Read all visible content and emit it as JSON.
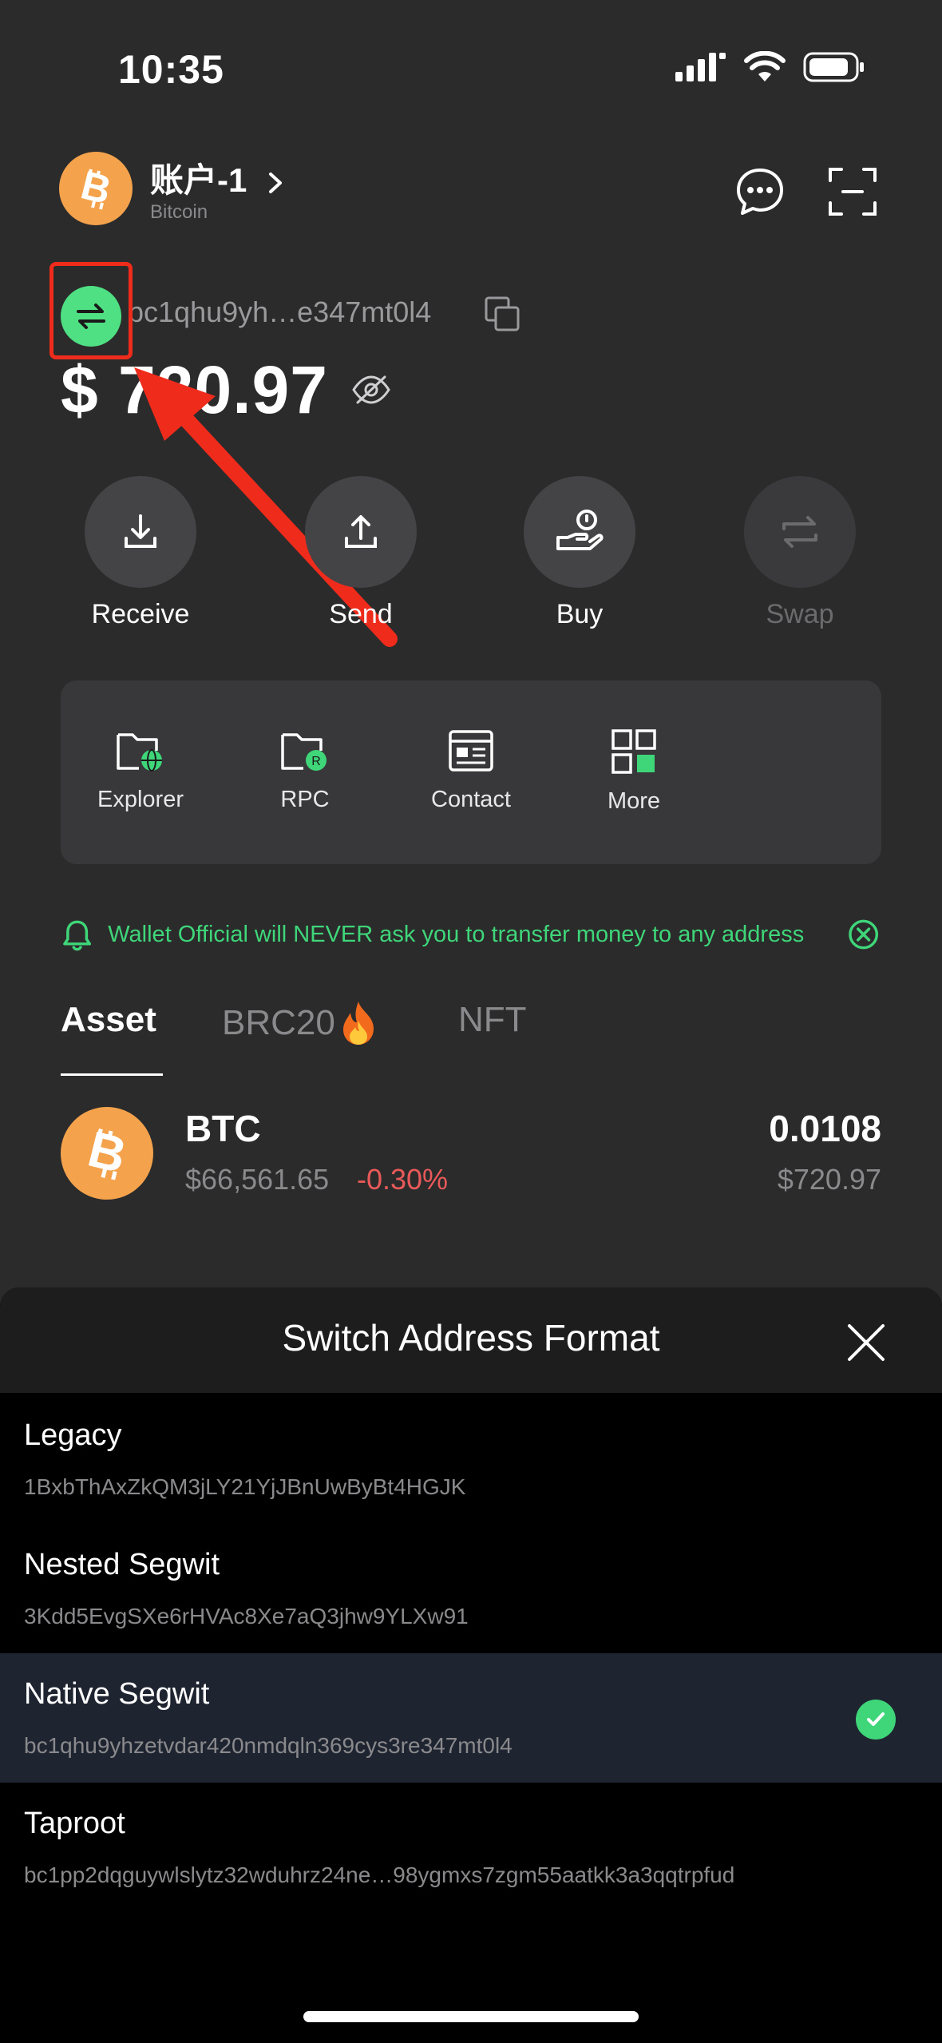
{
  "status_bar": {
    "time": "10:35"
  },
  "account": {
    "name": "账户-1",
    "network": "Bitcoin"
  },
  "address": {
    "short": "bc1qhu9yh…e347mt0l4"
  },
  "balance": {
    "value": "$ 720.97"
  },
  "actions": [
    {
      "label": "Receive"
    },
    {
      "label": "Send"
    },
    {
      "label": "Buy"
    },
    {
      "label": "Swap"
    }
  ],
  "tools": [
    {
      "label": "Explorer"
    },
    {
      "label": "RPC"
    },
    {
      "label": "Contact"
    },
    {
      "label": "More"
    }
  ],
  "notice": {
    "text": "Wallet Official will NEVER ask you to transfer money to any address"
  },
  "tabs": [
    {
      "label": "Asset"
    },
    {
      "label": "BRC20"
    },
    {
      "label": "NFT"
    }
  ],
  "asset": {
    "symbol": "BTC",
    "price": "$66,561.65",
    "change": "-0.30%",
    "amount": "0.0108",
    "value": "$720.97"
  },
  "sheet": {
    "title": "Switch Address Format",
    "options": [
      {
        "name": "Legacy",
        "address": "1BxbThAxZkQM3jLY21YjJBnUwByBt4HGJK",
        "selected": false
      },
      {
        "name": "Nested Segwit",
        "address": "3Kdd5EvgSXe6rHVAc8Xe7aQ3jhw9YLXw91",
        "selected": false
      },
      {
        "name": "Native Segwit",
        "address": "bc1qhu9yhzetvdar420nmdqln369cys3re347mt0l4",
        "selected": true
      },
      {
        "name": "Taproot",
        "address": "bc1pp2dqguywlslytz32wduhrz24ne…98ygmxs7zgm55aatkk3a3qqtrpfud",
        "selected": false
      }
    ]
  },
  "colors": {
    "accent_green": "#4ee083",
    "btc_orange": "#f4a34c",
    "negative": "#e85a5a",
    "highlight_red": "#ef2b1c"
  }
}
